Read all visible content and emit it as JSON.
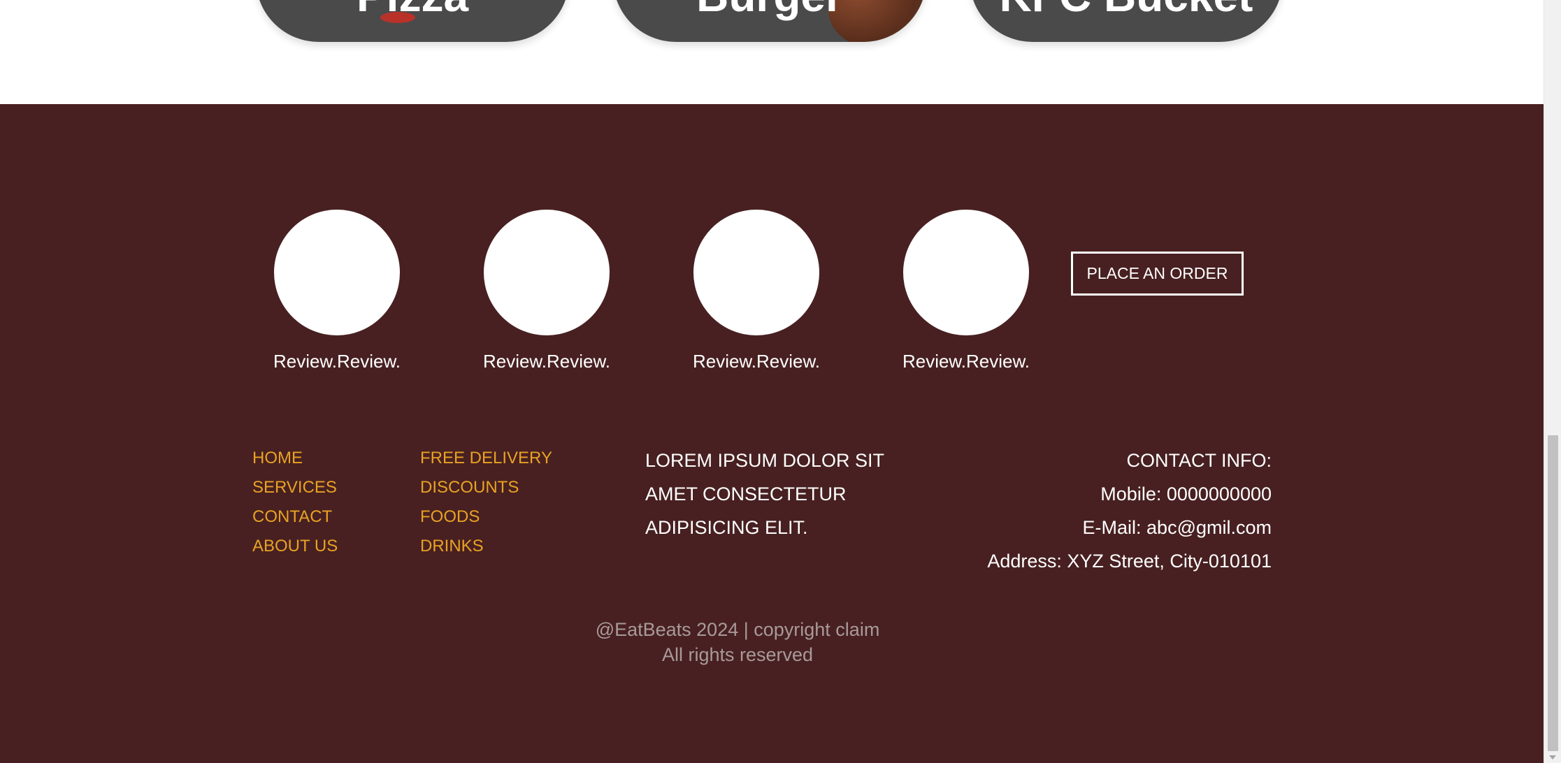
{
  "food_cards": [
    {
      "label": "Pizza"
    },
    {
      "label": "Burger"
    },
    {
      "label": "KFC Bucket"
    }
  ],
  "reviews": [
    {
      "text": "Review.Review."
    },
    {
      "text": "Review.Review."
    },
    {
      "text": "Review.Review."
    },
    {
      "text": "Review.Review."
    }
  ],
  "order_button": {
    "label": "PLACE AN ORDER"
  },
  "links": {
    "col1": [
      "HOME",
      "SERVICES",
      "CONTACT",
      "ABOUT US"
    ],
    "col2": [
      "FREE DELIVERY",
      "DISCOUNTS",
      "FOODS",
      "DRINKS"
    ]
  },
  "tagline": [
    "LOREM IPSUM DOLOR SIT",
    "AMET CONSECTETUR",
    "ADIPISICING ELIT."
  ],
  "contact": {
    "heading": "CONTACT INFO:",
    "mobile": "Mobile: 0000000000",
    "email": "E-Mail: abc@gmil.com",
    "address": "Address: XYZ Street, City-010101"
  },
  "copyright": {
    "line1": "@EatBeats 2024 | copyright claim",
    "line2": "All rights reserved"
  },
  "colors": {
    "footer_bg": "#482021",
    "link": "#e8a224",
    "card_bg": "#4a4a4a",
    "copyright_text": "#a89a99"
  }
}
